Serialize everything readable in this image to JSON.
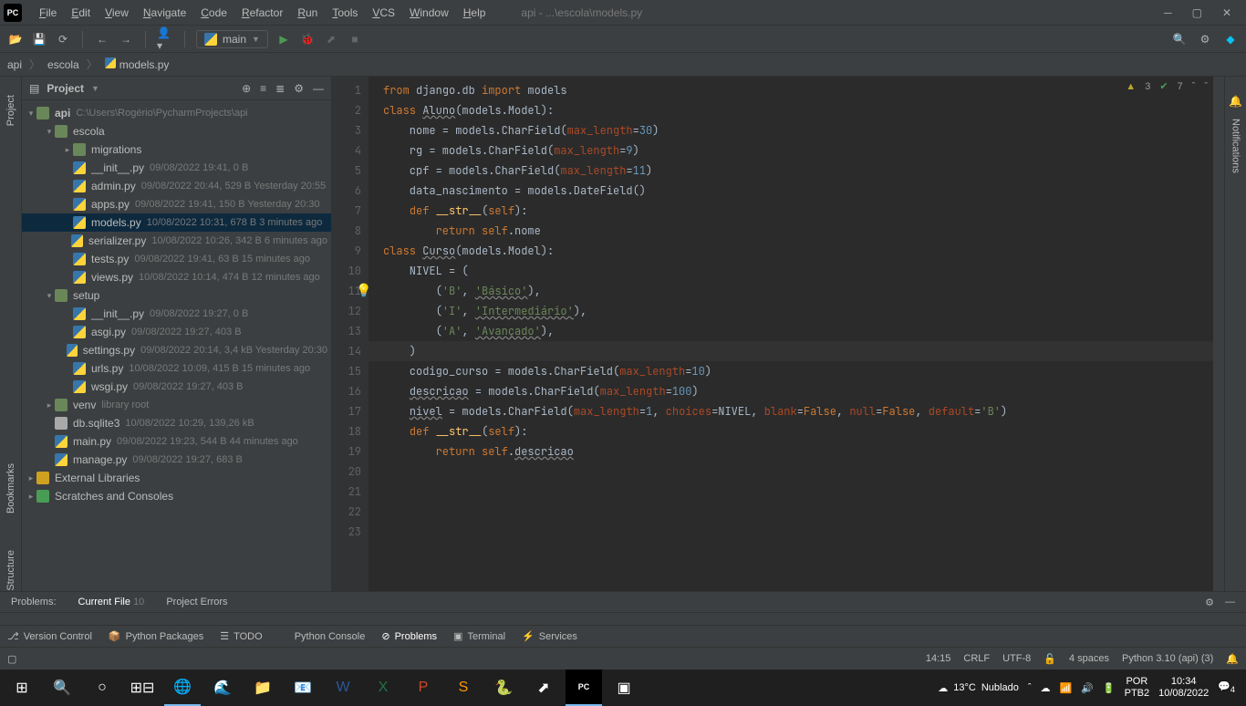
{
  "window": {
    "title": "api - ...\\escola\\models.py",
    "logo": "PC"
  },
  "menus": [
    "File",
    "Edit",
    "View",
    "Navigate",
    "Code",
    "Refactor",
    "Run",
    "Tools",
    "VCS",
    "Window",
    "Help"
  ],
  "toolbar": {
    "runcfg": "main"
  },
  "breadcrumb": {
    "root": "api",
    "folder": "escola",
    "file": "models.py"
  },
  "project": {
    "label": "Project",
    "rootName": "api",
    "rootPath": "C:\\Users\\Rogério\\PycharmProjects\\api",
    "tree": [
      {
        "depth": 1,
        "arrow": "down",
        "icon": "folder",
        "name": "escola",
        "meta": ""
      },
      {
        "depth": 2,
        "arrow": "right",
        "icon": "pkg",
        "name": "migrations",
        "meta": ""
      },
      {
        "depth": 2,
        "arrow": "",
        "icon": "py",
        "name": "__init__.py",
        "meta": "09/08/2022 19:41, 0 B"
      },
      {
        "depth": 2,
        "arrow": "",
        "icon": "py",
        "name": "admin.py",
        "meta": "09/08/2022 20:44, 529 B Yesterday 20:55"
      },
      {
        "depth": 2,
        "arrow": "",
        "icon": "py",
        "name": "apps.py",
        "meta": "09/08/2022 19:41, 150 B Yesterday 20:30"
      },
      {
        "depth": 2,
        "arrow": "",
        "icon": "py",
        "name": "models.py",
        "meta": "10/08/2022 10:31, 678 B 3 minutes ago",
        "selected": true
      },
      {
        "depth": 2,
        "arrow": "",
        "icon": "py",
        "name": "serializer.py",
        "meta": "10/08/2022 10:26, 342 B 6 minutes ago"
      },
      {
        "depth": 2,
        "arrow": "",
        "icon": "py",
        "name": "tests.py",
        "meta": "09/08/2022 19:41, 63 B 15 minutes ago"
      },
      {
        "depth": 2,
        "arrow": "",
        "icon": "py",
        "name": "views.py",
        "meta": "10/08/2022 10:14, 474 B 12 minutes ago"
      },
      {
        "depth": 1,
        "arrow": "down",
        "icon": "folder",
        "name": "setup",
        "meta": ""
      },
      {
        "depth": 2,
        "arrow": "",
        "icon": "py",
        "name": "__init__.py",
        "meta": "09/08/2022 19:27, 0 B"
      },
      {
        "depth": 2,
        "arrow": "",
        "icon": "py",
        "name": "asgi.py",
        "meta": "09/08/2022 19:27, 403 B"
      },
      {
        "depth": 2,
        "arrow": "",
        "icon": "py",
        "name": "settings.py",
        "meta": "09/08/2022 20:14, 3,4 kB Yesterday 20:30"
      },
      {
        "depth": 2,
        "arrow": "",
        "icon": "py",
        "name": "urls.py",
        "meta": "10/08/2022 10:09, 415 B 15 minutes ago"
      },
      {
        "depth": 2,
        "arrow": "",
        "icon": "py",
        "name": "wsgi.py",
        "meta": "09/08/2022 19:27, 403 B"
      },
      {
        "depth": 1,
        "arrow": "right",
        "icon": "folder",
        "name": "venv",
        "meta": "library root"
      },
      {
        "depth": 1,
        "arrow": "",
        "icon": "db",
        "name": "db.sqlite3",
        "meta": "10/08/2022 10:29, 139,26 kB"
      },
      {
        "depth": 1,
        "arrow": "",
        "icon": "py",
        "name": "main.py",
        "meta": "09/08/2022 19:23, 544 B 44 minutes ago"
      },
      {
        "depth": 1,
        "arrow": "",
        "icon": "py",
        "name": "manage.py",
        "meta": "09/08/2022 19:27, 683 B"
      }
    ],
    "extLib": "External Libraries",
    "scratches": "Scratches and Consoles"
  },
  "editor": {
    "inspections": {
      "warnings": 3,
      "weak": 7
    },
    "lines": [
      {
        "n": 1,
        "html": "<span class='kw'>from</span> django.db <span class='kw'>import</span> models"
      },
      {
        "n": 2,
        "html": ""
      },
      {
        "n": 3,
        "html": "<span class='kw'>class</span> <span class='decl'>Aluno</span>(models.Model):"
      },
      {
        "n": 4,
        "html": "    nome = models.CharField(<span class='param'>max_length</span>=<span class='num'>30</span>)"
      },
      {
        "n": 5,
        "html": "    rg = models.CharField(<span class='param'>max_length</span>=<span class='num'>9</span>)"
      },
      {
        "n": 6,
        "html": "    cpf = models.CharField(<span class='param'>max_length</span>=<span class='num'>11</span>)"
      },
      {
        "n": 7,
        "html": "    data_nascimento = models.DateField()"
      },
      {
        "n": 8,
        "html": ""
      },
      {
        "n": 9,
        "html": "    <span class='kw'>def</span> <span class='fn'>__str__</span>(<span class='kw'>self</span>):"
      },
      {
        "n": 10,
        "html": "        <span class='kw'>return</span> <span class='kw'>self</span>.nome"
      },
      {
        "n": 11,
        "html": ""
      },
      {
        "n": 12,
        "html": "<span class='kw'>class</span> <span class='decl'>Curso</span>(models.Model):"
      },
      {
        "n": 13,
        "html": "    NIVEL = ("
      },
      {
        "n": 14,
        "html": "        (<span class='str'>'B'</span>, <span class='str decl'>'Básico'</span>),",
        "hl": true,
        "bulb": true
      },
      {
        "n": 15,
        "html": "        (<span class='str'>'I'</span>, <span class='str decl'>'Intermediário'</span>),"
      },
      {
        "n": 16,
        "html": "        (<span class='str'>'A'</span>, <span class='str decl'>'Avançado'</span>),"
      },
      {
        "n": 17,
        "html": "    )"
      },
      {
        "n": 18,
        "html": "    codigo_curso = models.CharField(<span class='param'>max_length</span>=<span class='num'>10</span>)"
      },
      {
        "n": 19,
        "html": "    <span class='decl'>descricao</span> = models.CharField(<span class='param'>max_length</span>=<span class='num'>100</span>)"
      },
      {
        "n": 20,
        "html": "    <span class='decl'>nivel</span> = models.CharField(<span class='param'>max_length</span>=<span class='num'>1</span>, <span class='param'>choices</span>=NIVEL, <span class='param'>blank</span>=<span class='kw'>False</span>, <span class='param'>null</span>=<span class='kw'>False</span>, <span class='param'>default</span>=<span class='str'>'B'</span>)"
      },
      {
        "n": 21,
        "html": ""
      },
      {
        "n": 22,
        "html": "    <span class='kw'>def</span> <span class='fn'>__str__</span>(<span class='kw'>self</span>):"
      },
      {
        "n": 23,
        "html": "        <span class='kw'>return</span> <span class='kw'>self</span>.<span class='decl'>descricao</span>"
      }
    ]
  },
  "problems": {
    "tab1": "Problems:",
    "tab2": "Current File",
    "count2": "10",
    "tab3": "Project Errors"
  },
  "bottomTools": {
    "versionControl": "Version Control",
    "pythonPackages": "Python Packages",
    "todo": "TODO",
    "pythonConsole": "Python Console",
    "problems": "Problems",
    "terminal": "Terminal",
    "services": "Services"
  },
  "statusbar": {
    "pos": "14:15",
    "eol": "CRLF",
    "enc": "UTF-8",
    "indent": "4 spaces",
    "interp": "Python 3.10 (api) (3)"
  },
  "sideTabs": {
    "project": "Project",
    "bookmarks": "Bookmarks",
    "structure": "Structure",
    "notifications": "Notifications"
  },
  "taskbar": {
    "weather_temp": "13°C",
    "weather_cond": "Nublado",
    "lang1": "POR",
    "lang2": "PTB2",
    "time": "10:34",
    "date": "10/08/2022",
    "notif": "4"
  }
}
